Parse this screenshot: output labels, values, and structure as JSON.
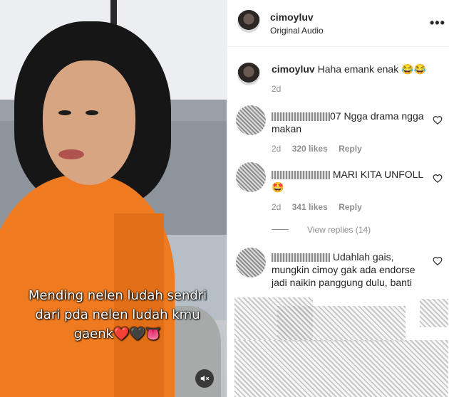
{
  "post": {
    "username": "cimoyluv",
    "audio": "Original Audio",
    "caption_lines": [
      "Mending nelen ludah sendri",
      "dari pda nelen ludah kmu",
      "gaenk❤️🖤👅"
    ]
  },
  "comments": [
    {
      "user": "cimoyluv",
      "text": "Haha emank enak 😂😂",
      "age": "2d"
    },
    {
      "user_suffix": "07",
      "text": "Ngga drama ngga makan",
      "age": "2d",
      "likes": "320 likes",
      "reply": "Reply"
    },
    {
      "text": "MARI KITA UNFOLL 🤩",
      "age": "2d",
      "likes": "341 likes",
      "reply": "Reply",
      "view_replies": "View replies (14)"
    },
    {
      "text": "Udahlah gais, mungkin cimoy gak ada endorse jadi naikin panggung dulu, banti"
    }
  ],
  "icons": {
    "more": "more-options-icon",
    "mute": "muted-speaker-icon",
    "heart": "heart-outline-icon"
  }
}
